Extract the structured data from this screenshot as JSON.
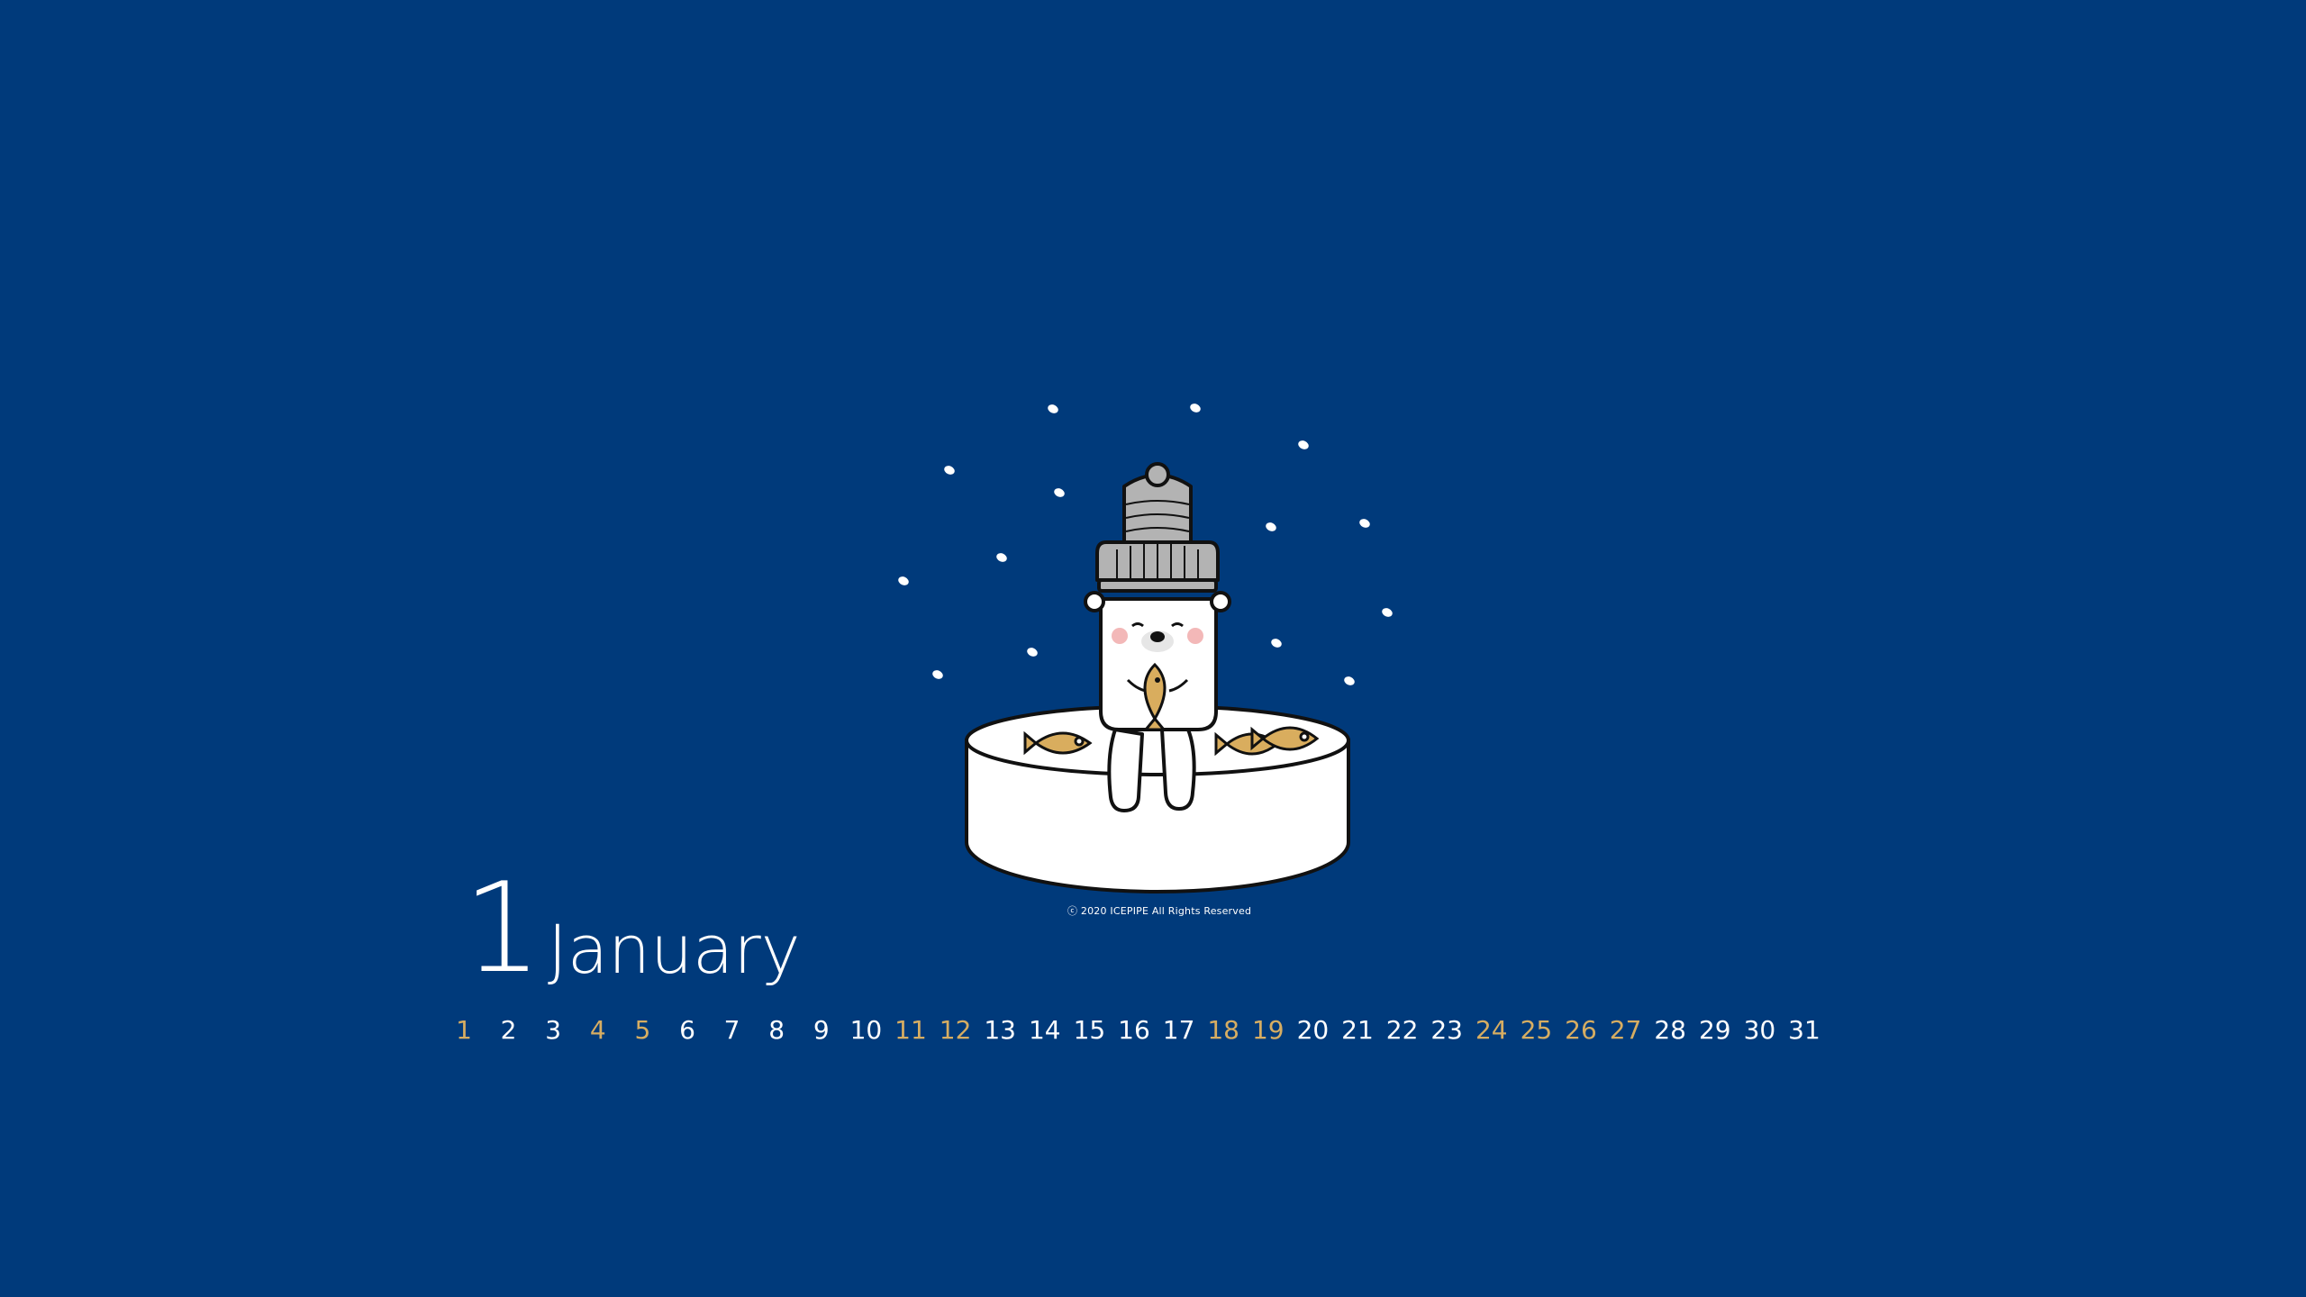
{
  "copyright": "ⓒ 2020 ICEPIPE All Rights Reserved",
  "calendar": {
    "month_number": "1",
    "month_name": "January",
    "days": [
      "1",
      "2",
      "3",
      "4",
      "5",
      "6",
      "7",
      "8",
      "9",
      "10",
      "11",
      "12",
      "13",
      "14",
      "15",
      "16",
      "17",
      "18",
      "19",
      "20",
      "21",
      "22",
      "23",
      "24",
      "25",
      "26",
      "27",
      "28",
      "29",
      "30",
      "31"
    ],
    "highlighted_days": [
      "1",
      "4",
      "5",
      "11",
      "12",
      "18",
      "19",
      "24",
      "25",
      "26",
      "27"
    ]
  },
  "colors": {
    "background": "#003a7b",
    "text": "#ffffff",
    "highlight": "#d6ad62",
    "fish": "#d9ad5e",
    "hat": "#b3b3b3"
  },
  "icons": {
    "illustration": "polar-bear-on-ice-floe",
    "fish": "taiyaki-fish-icon",
    "snow": "snowflake-dot-icon"
  }
}
